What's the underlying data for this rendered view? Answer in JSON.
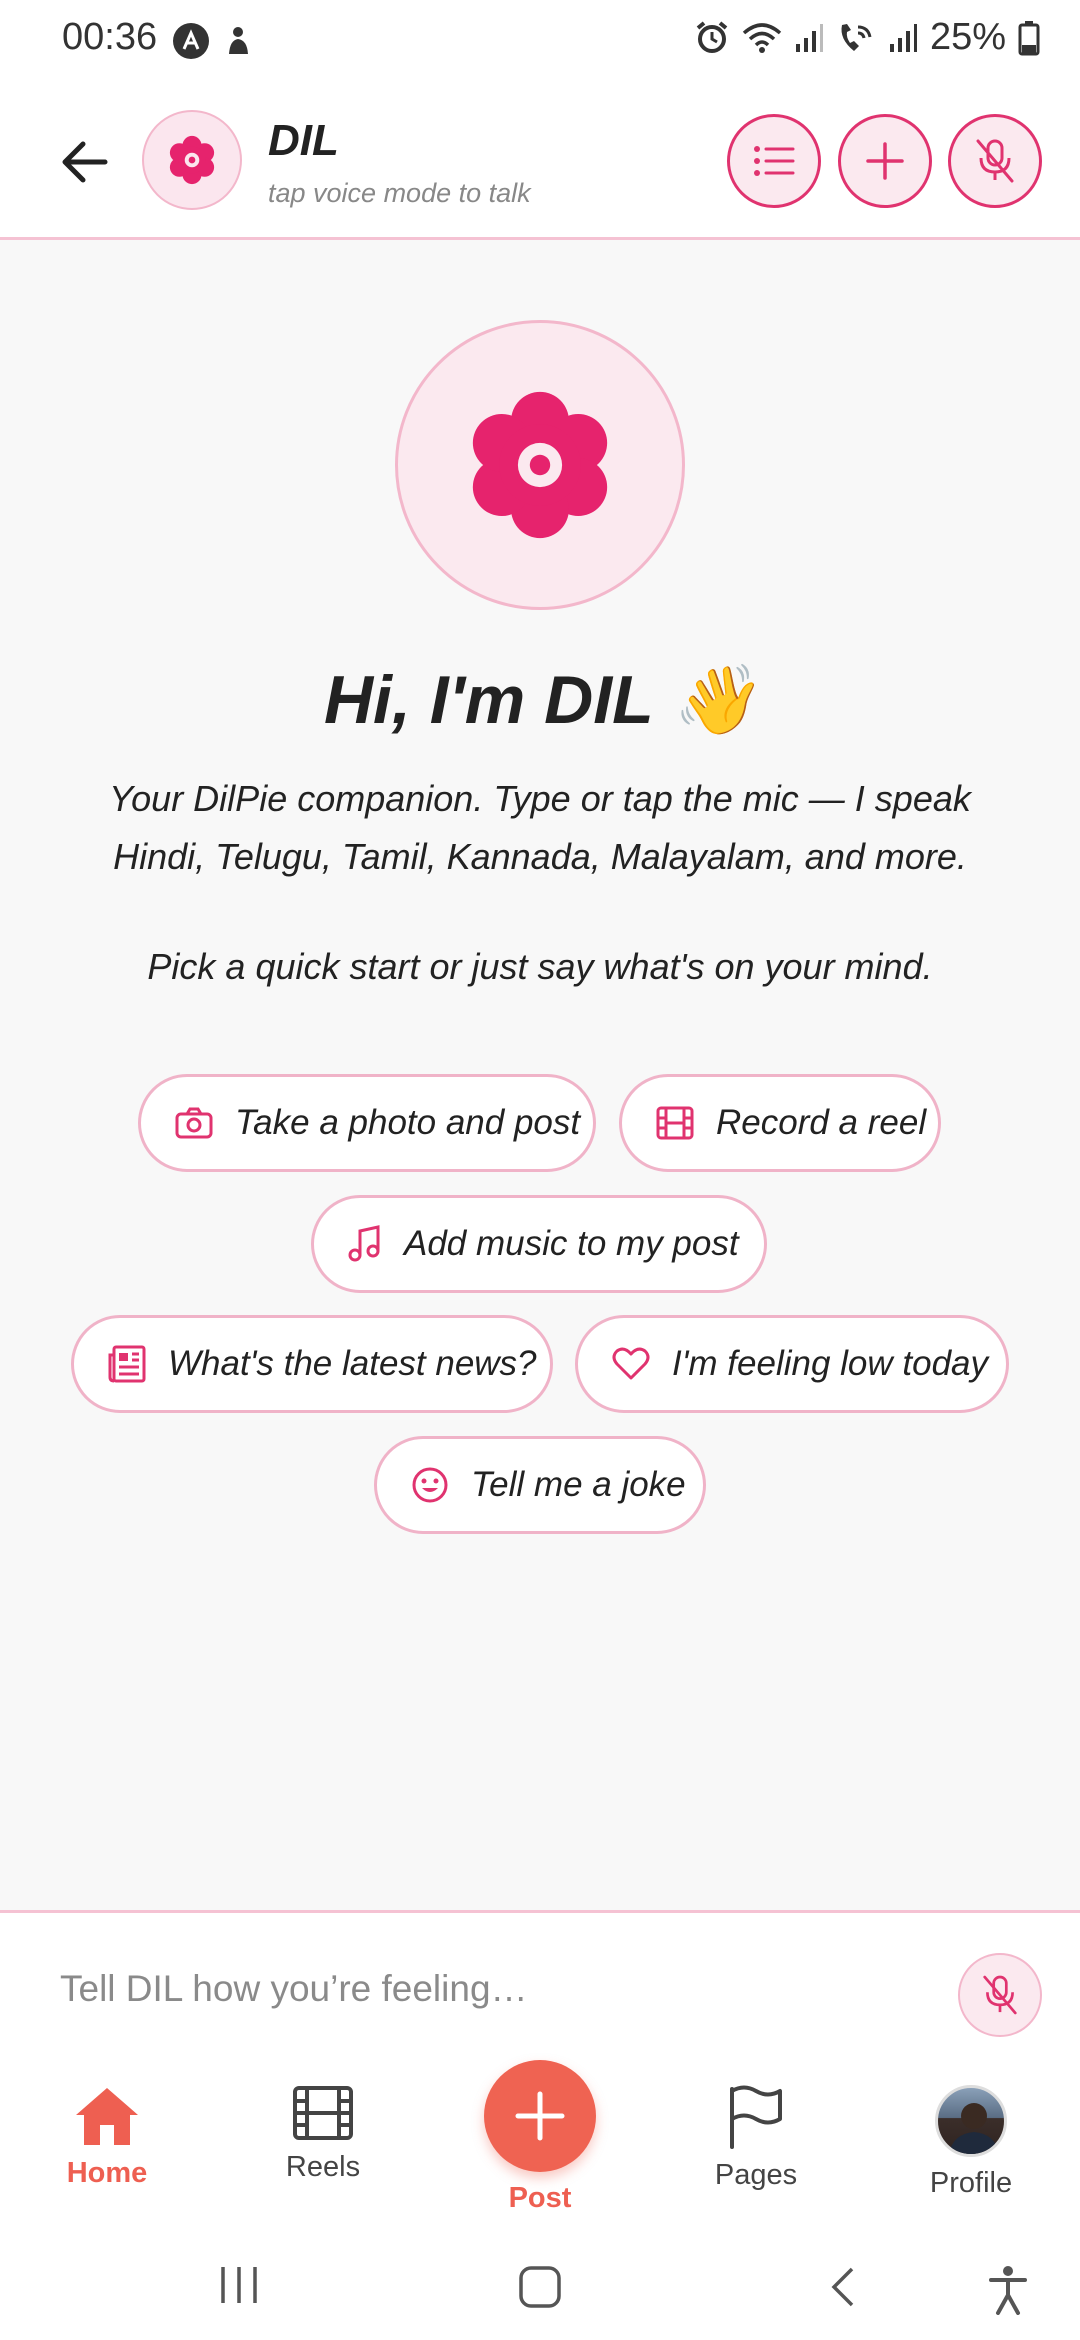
{
  "status_bar": {
    "time": "00:36",
    "battery": "25%",
    "icons": [
      "autopilot-icon",
      "notification-icon",
      "alarm-icon",
      "wifi-icon",
      "signal-icon",
      "wifi-calling-icon",
      "signal-icon",
      "battery-icon"
    ]
  },
  "header": {
    "title": "DIL",
    "subtitle": "tap voice mode to talk",
    "buttons": [
      "list-icon",
      "plus-icon",
      "mic-off-icon"
    ]
  },
  "hero": {
    "title": "Hi, I'm DIL 👋",
    "description": "Your DilPie companion. Type or tap the mic — I speak Hindi, Telugu, Tamil, Kannada, Malayalam, and more.",
    "hint": "Pick a quick start or just say what's on your mind."
  },
  "quick_starts": [
    {
      "label": "Take a photo and post",
      "icon": "camera-icon"
    },
    {
      "label": "Record a reel",
      "icon": "film-icon"
    },
    {
      "label": "Add music to my post",
      "icon": "music-icon"
    },
    {
      "label": "What's the latest news?",
      "icon": "newspaper-icon"
    },
    {
      "label": "I'm feeling low today",
      "icon": "heart-icon"
    },
    {
      "label": "Tell me a joke",
      "icon": "smile-icon"
    }
  ],
  "input": {
    "placeholder": "Tell DIL how you’re feeling…"
  },
  "bottom_nav": {
    "home": "Home",
    "reels": "Reels",
    "post": "Post",
    "pages": "Pages",
    "profile": "Profile"
  },
  "colors": {
    "accent_pink": "#e0336f",
    "pink_light": "#fbe9ef",
    "nav_active": "#ee5f51"
  }
}
